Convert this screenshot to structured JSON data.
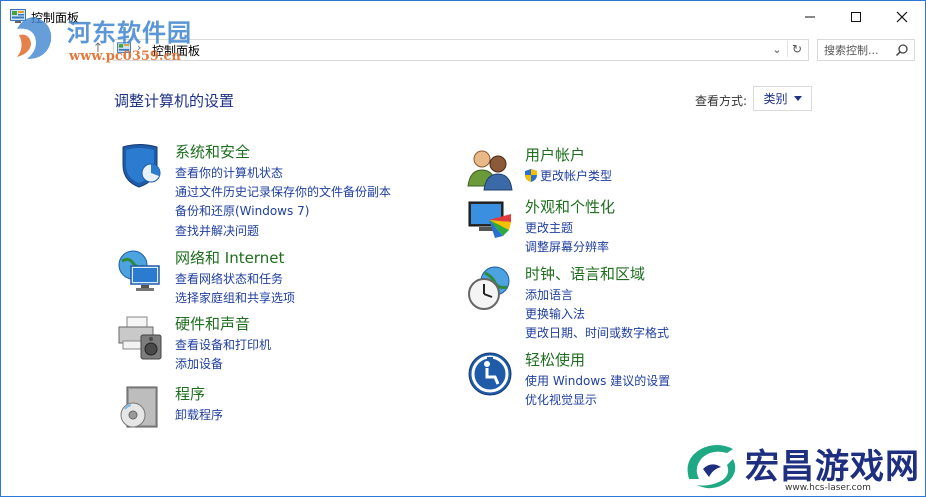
{
  "window": {
    "title": "控制面板"
  },
  "address": {
    "path": "控制面板",
    "separator": "›"
  },
  "search": {
    "placeholder": "搜索控制..."
  },
  "heading": "调整计算机的设置",
  "view": {
    "label": "查看方式:",
    "value": "类别"
  },
  "left_categories": [
    {
      "title": "系统和安全",
      "icon": "security-shield-icon",
      "links": [
        "查看你的计算机状态",
        "通过文件历史记录保存你的文件备份副本",
        "备份和还原(Windows 7)",
        "查找并解决问题"
      ]
    },
    {
      "title": "网络和 Internet",
      "icon": "network-globe-icon",
      "links": [
        "查看网络状态和任务",
        "选择家庭组和共享选项"
      ]
    },
    {
      "title": "硬件和声音",
      "icon": "printer-speaker-icon",
      "links": [
        "查看设备和打印机",
        "添加设备"
      ]
    },
    {
      "title": "程序",
      "icon": "programs-disc-icon",
      "links": [
        "卸载程序"
      ]
    }
  ],
  "right_categories": [
    {
      "title": "用户帐户",
      "icon": "users-icon",
      "links": [
        "更改帐户类型"
      ]
    },
    {
      "title": "外观和个性化",
      "icon": "monitor-palette-icon",
      "links": [
        "更改主题",
        "调整屏幕分辨率"
      ]
    },
    {
      "title": "时钟、语言和区域",
      "icon": "clock-globe-icon",
      "links": [
        "添加语言",
        "更换输入法",
        "更改日期、时间或数字格式"
      ]
    },
    {
      "title": "轻松使用",
      "icon": "accessibility-icon",
      "links": [
        "使用 Windows 建议的设置",
        "优化视觉显示"
      ]
    }
  ],
  "watermarks": {
    "top_left": {
      "title": "河东软件园",
      "url": "www.pc0359.cn"
    },
    "bottom_right": {
      "title": "宏昌游戏网",
      "url": "www.hcs-laser.com"
    }
  },
  "colors": {
    "link": "#1f3fa0",
    "category_title": "#1e6e1e",
    "heading": "#1e3287",
    "window_border": "#2b78d8"
  }
}
